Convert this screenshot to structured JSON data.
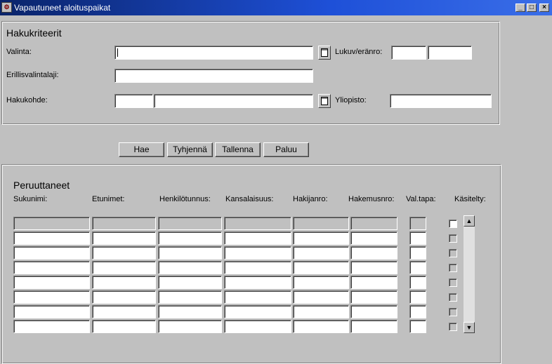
{
  "window": {
    "title": "Vapautuneet aloituspaikat",
    "app_icon": "oracle-forms-icon",
    "minimize": "minimize-icon",
    "maximize": "maximize-icon",
    "close": "close-icon"
  },
  "criteria": {
    "heading": "Hakukriteerit",
    "valinta_label": "Valinta:",
    "valinta_value": "",
    "lukuvuosi_label": "Lukuv/eränro:",
    "lukuvuosi_value": "",
    "eranro_value": "",
    "erillis_label": "Erillisvalintalaji:",
    "erillis_value": "",
    "hakukohde_label": "Hakukohde:",
    "hakukohde_code": "",
    "hakukohde_name": "",
    "yliopisto_label": "Yliopisto:",
    "yliopisto_value": ""
  },
  "buttons": {
    "hae": "Hae",
    "tyhjenna": "Tyhjennä",
    "tallenna": "Tallenna",
    "paluu": "Paluu"
  },
  "results": {
    "heading": "Peruuttaneet",
    "columns": [
      "Sukunimi:",
      "Etunimet:",
      "Henkilötunnus:",
      "Kansalaisuus:",
      "Hakijanro:",
      "Hakemusnro:",
      "Val.tapa:",
      "Käsitelty:"
    ],
    "row_count": 8
  }
}
